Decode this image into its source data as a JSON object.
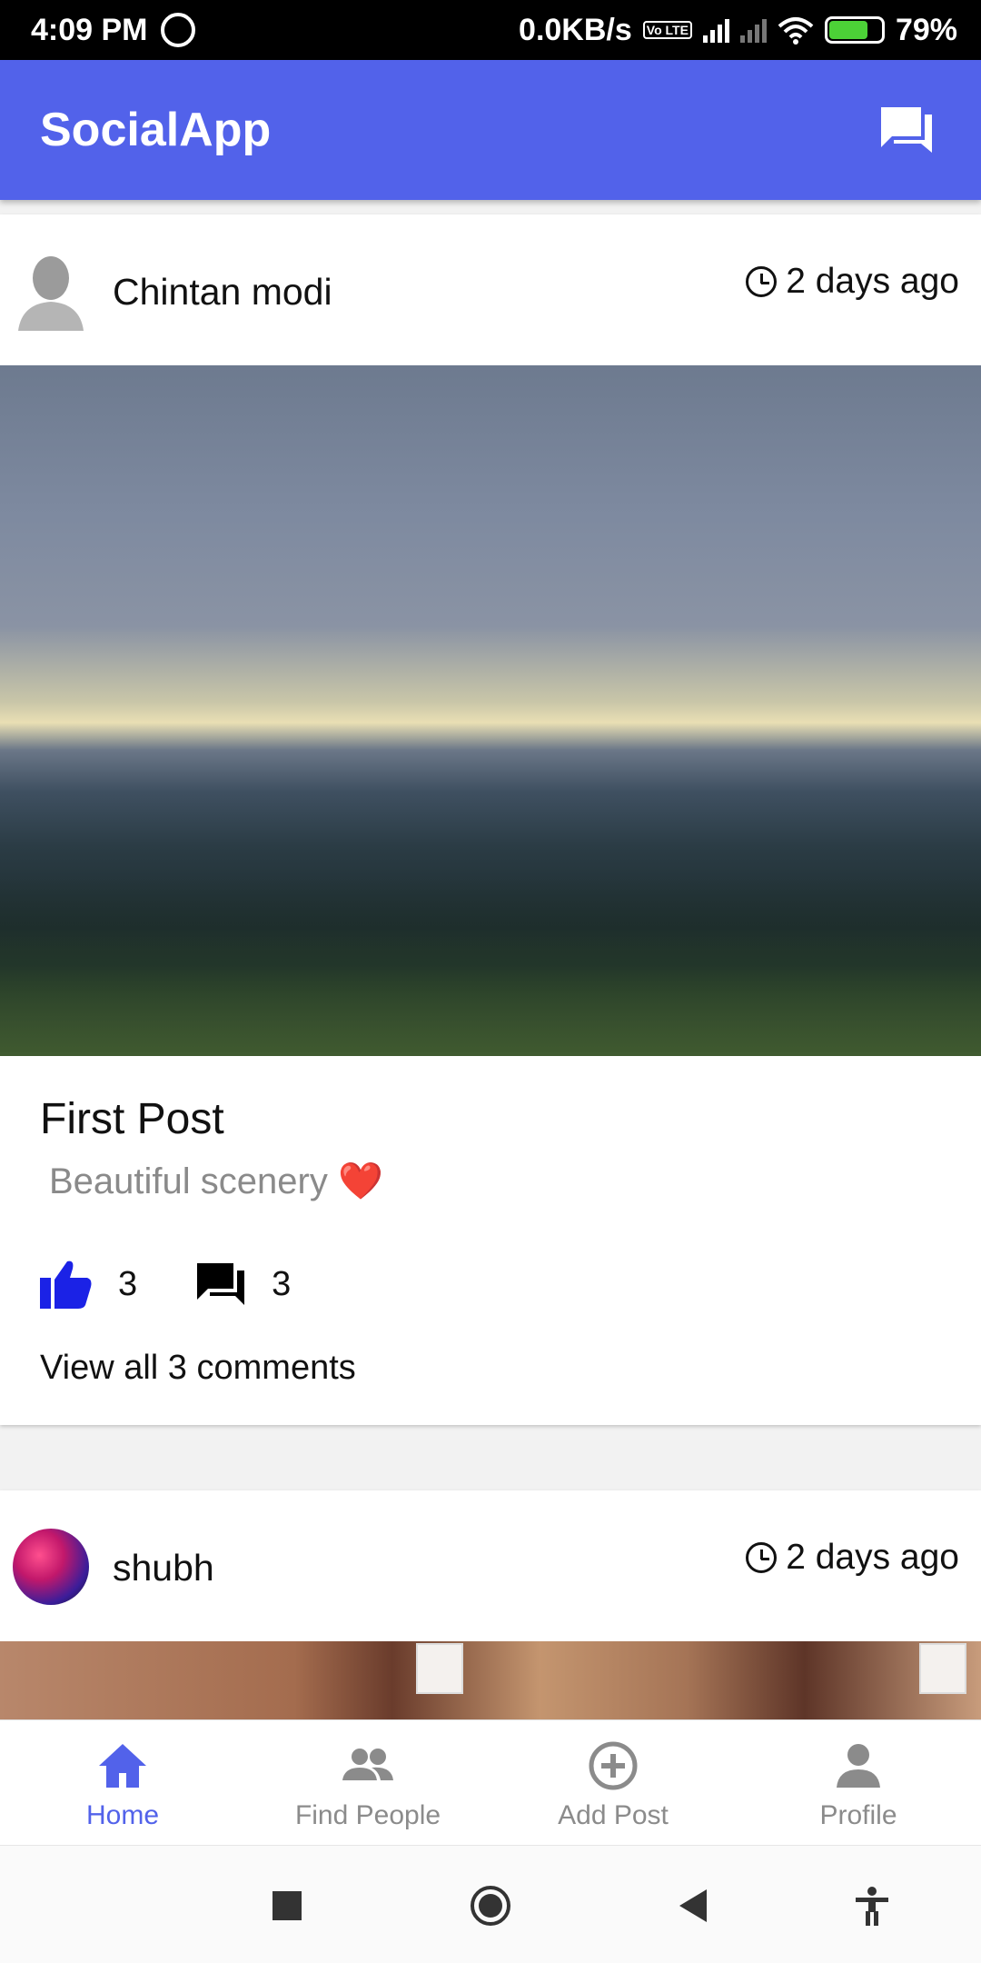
{
  "status_bar": {
    "time": "4:09 PM",
    "net_speed": "0.0KB/s",
    "volte": "Vo LTE",
    "battery": "79%"
  },
  "app_bar": {
    "title": "SocialApp",
    "chat_icon": "chat-icon"
  },
  "posts": [
    {
      "author": "Chintan modi",
      "time": "2 days ago",
      "title": "First Post",
      "description": "Beautiful scenery ❤️",
      "likes": "3",
      "comments": "3",
      "view_all": "View all 3 comments"
    },
    {
      "author": "shubh",
      "time": "2 days ago"
    }
  ],
  "bottom_nav": {
    "items": [
      {
        "label": "Home",
        "icon": "home-icon",
        "active": true
      },
      {
        "label": "Find People",
        "icon": "people-icon",
        "active": false
      },
      {
        "label": "Add Post",
        "icon": "add-circle-icon",
        "active": false
      },
      {
        "label": "Profile",
        "icon": "person-icon",
        "active": false
      }
    ]
  },
  "colors": {
    "primary": "#5262ea",
    "like": "#1b22e6",
    "heart": "#e0202a"
  }
}
